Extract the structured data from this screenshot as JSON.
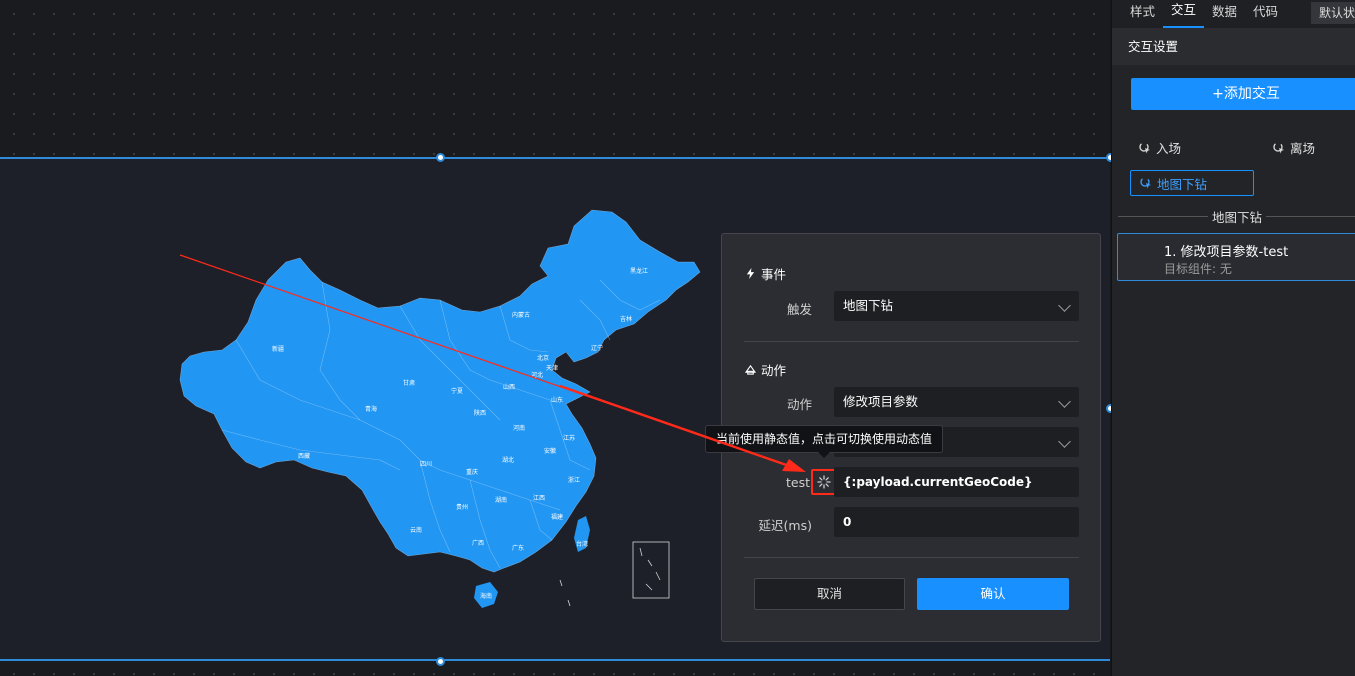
{
  "side_panel": {
    "tabs": [
      {
        "label": "样式",
        "active": false
      },
      {
        "label": "交互",
        "active": true
      },
      {
        "label": "数据",
        "active": false
      },
      {
        "label": "代码",
        "active": false
      }
    ],
    "state_label": "默认状",
    "section_title": "交互设置",
    "add_button": "+添加交互",
    "events": {
      "enter": "入场",
      "leave": "离场",
      "selected": "地图下钻"
    },
    "group_title": "地图下钻",
    "interaction_card": {
      "title": "1. 修改项目参数-test",
      "subtitle": "目标组件: 无"
    }
  },
  "dialog": {
    "event_header": "事件",
    "trigger_label": "触发",
    "trigger_value": "地图下钻",
    "action_header": "动作",
    "action_label": "动作",
    "action_value": "修改项目参数",
    "param_label": "test",
    "param_value": "{:payload.currentGeoCode}",
    "delay_label": "延迟(ms)",
    "delay_value": "0",
    "cancel_button": "取消",
    "confirm_button": "确认"
  },
  "tooltip": "当前使用静态值，点击可切换使用动态值",
  "map": {
    "fill_color": "#2196f3",
    "province_labels": [
      "新疆",
      "西藏",
      "青海",
      "甘肃",
      "内蒙古",
      "黑龙江",
      "吉林",
      "辽宁",
      "北京",
      "天津",
      "河北",
      "山西",
      "宁夏",
      "陕西",
      "山东",
      "河南",
      "江苏",
      "安徽",
      "湖北",
      "四川",
      "重庆",
      "浙江",
      "湖南",
      "江西",
      "贵州",
      "云南",
      "广西",
      "福建",
      "广东",
      "台湾",
      "海南"
    ]
  },
  "colors": {
    "accent": "#1890ff",
    "annotation": "#ff2a1a"
  }
}
